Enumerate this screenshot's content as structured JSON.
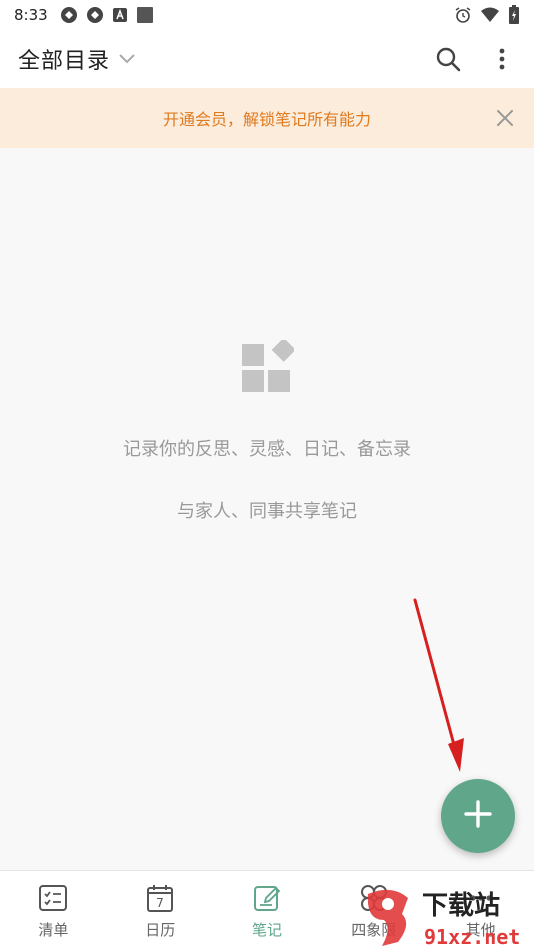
{
  "status_bar": {
    "time": "8:33",
    "left_icons": [
      "sync-icon",
      "sync-icon",
      "a-badge-icon",
      "square-icon"
    ],
    "right_icons": [
      "alarm-icon",
      "wifi-icon",
      "battery-icon"
    ]
  },
  "app_bar": {
    "title": "全部目录",
    "icons": [
      "chevron-down-icon",
      "search-icon",
      "more-vertical-icon"
    ]
  },
  "banner": {
    "text": "开通会员，解锁笔记所有能力",
    "text_color": "#e07a1f",
    "background": "#fcecdb"
  },
  "empty_state": {
    "icon": "widgets-icon",
    "line1": "记录你的反思、灵感、日记、备忘录",
    "line2": "与家人、同事共享笔记"
  },
  "fab": {
    "icon": "plus-icon",
    "color": "#5fa68a"
  },
  "bottom_nav": {
    "items": [
      {
        "label": "清单",
        "icon": "checklist-icon"
      },
      {
        "label": "日历",
        "icon": "calendar-icon",
        "day": "7"
      },
      {
        "label": "笔记",
        "icon": "note-edit-icon",
        "active": true
      },
      {
        "label": "四象限",
        "icon": "quadrant-icon"
      },
      {
        "label": "其他",
        "icon": "more-icon"
      }
    ],
    "active_color": "#5fa68a"
  },
  "watermark": {
    "line1": "下载站",
    "line2": "91xz.net"
  }
}
